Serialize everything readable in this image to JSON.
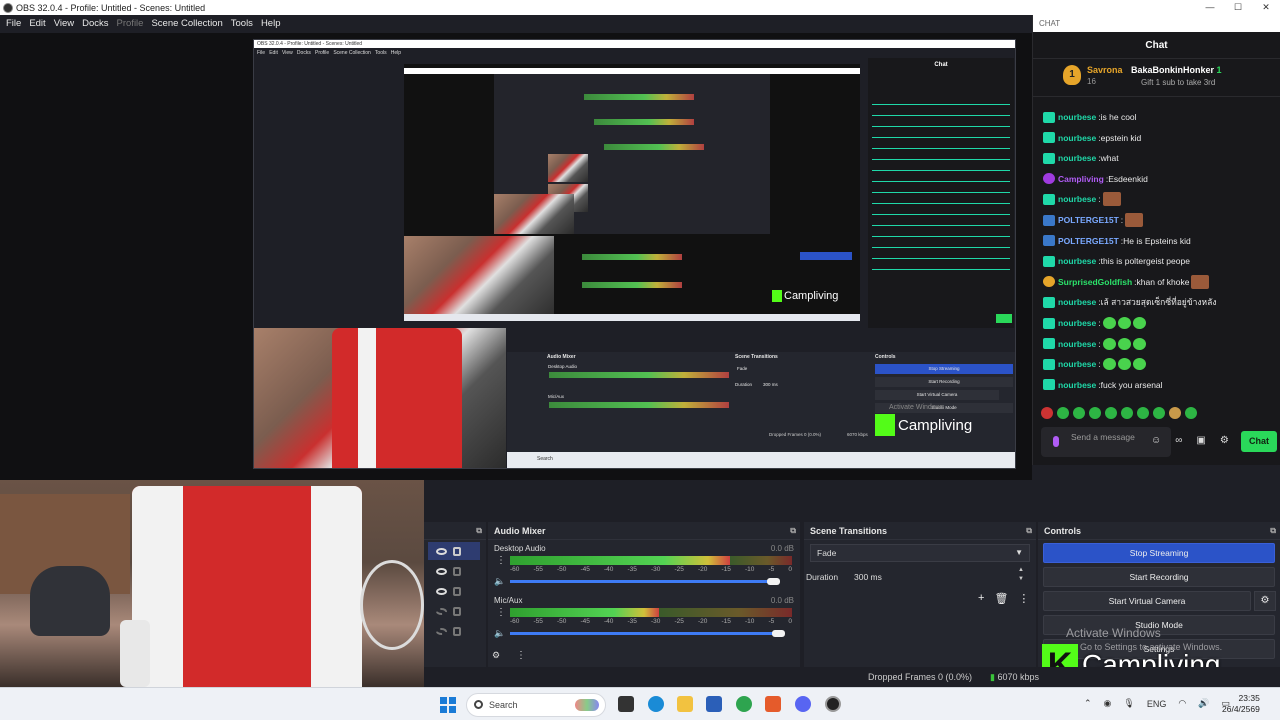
{
  "window": {
    "title": "OBS 32.0.4 - Profile: Untitled - Scenes: Untitled",
    "controls": [
      "—",
      "☐",
      "✕"
    ]
  },
  "menu": [
    "File",
    "Edit",
    "View",
    "Docks",
    "Profile",
    "Scene Collection",
    "Tools",
    "Help"
  ],
  "chat": {
    "dock_title": "CHAT",
    "header": "Chat",
    "gift": {
      "rank": "1",
      "user": "Savrona",
      "count": "16",
      "top_user": "BakaBonkinHonker",
      "top_count": "1",
      "subtext": "Gift 1 sub to take 3rd"
    },
    "messages": [
      {
        "user": "nourbese",
        "text": "is he cool",
        "kind": "t"
      },
      {
        "user": "nourbese",
        "text": "epstein kid",
        "kind": "t"
      },
      {
        "user": "nourbese",
        "text": "what",
        "kind": "t"
      },
      {
        "user": "Campliving",
        "text": "Esdeenkid",
        "kind": "p"
      },
      {
        "user": "nourbese",
        "text": "",
        "kind": "t",
        "emote": true
      },
      {
        "user": "POLTERGE15T",
        "text": "",
        "kind": "b",
        "emote": true
      },
      {
        "user": "POLTERGE15T",
        "text": "He is Epsteins kid",
        "kind": "b"
      },
      {
        "user": "nourbese",
        "text": "this is poltergeist peope",
        "kind": "t"
      },
      {
        "user": "SurprisedGoldfish",
        "text": "khan of khoke",
        "kind": "g",
        "emote": true
      },
      {
        "user": "nourbese",
        "text": "เล้ สาวสวยสุดเซ็กซี่ที่อยู่ข้างหลัง",
        "kind": "t"
      },
      {
        "user": "nourbese",
        "text": "",
        "kind": "t",
        "gemote": true
      },
      {
        "user": "nourbese",
        "text": "",
        "kind": "t",
        "gemote": true
      },
      {
        "user": "nourbese",
        "text": "",
        "kind": "t",
        "gemote": true
      },
      {
        "user": "nourbese",
        "text": "fuck you arsenal",
        "kind": "t"
      }
    ],
    "input_placeholder": "Send a message",
    "send_label": "Chat"
  },
  "docks": {
    "audio_mixer": {
      "title": "Audio Mixer",
      "scale": [
        "-60",
        "-55",
        "-50",
        "-45",
        "-40",
        "-35",
        "-30",
        "-25",
        "-20",
        "-15",
        "-10",
        "-5",
        "0"
      ],
      "channels": [
        {
          "name": "Desktop Audio",
          "db": "0.0 dB",
          "level": 0.78,
          "volume": 0.98
        },
        {
          "name": "Mic/Aux",
          "db": "0.0 dB",
          "level": 0.53,
          "volume": 1.0
        }
      ]
    },
    "scene_transitions": {
      "title": "Scene Transitions",
      "transition": "Fade",
      "duration_label": "Duration",
      "duration_value": "300 ms"
    },
    "controls": {
      "title": "Controls",
      "stop_streaming": "Stop Streaming",
      "start_recording": "Start Recording",
      "start_virtual_camera": "Start Virtual Camera",
      "studio_mode": "Studio Mode",
      "settings": "Settings"
    }
  },
  "watermark": {
    "activate": "Activate Windows",
    "settings_hint": "Go to Settings to activate Windows."
  },
  "overlay": {
    "k": "K",
    "channel": "Campliving"
  },
  "status": {
    "dropped": "Dropped Frames 0 (0.0%)",
    "kbps": "6070 kbps"
  },
  "taskbar": {
    "search": "Search",
    "lang": "ENG",
    "time": "23:35",
    "date": "26/4/2569"
  },
  "nested_preview": {
    "title": "OBS 32.0.4 - Profile: Untitled - Scenes: Untitled",
    "menu": "File   Edit   View   Docks   Profile   Scene Collection   Tools   Help",
    "chat": "Chat",
    "audio": "Audio Mixer",
    "transitions": "Scene Transitions",
    "controls": "Controls",
    "stop": "Stop Streaming",
    "rec": "Start Recording",
    "vcam": "Start Virtual Camera",
    "studio": "Studio Mode",
    "fade": "Fade",
    "duration": "Duration",
    "dur_val": "300 ms",
    "desktop": "Desktop Audio",
    "mic": "Mic/Aux",
    "dropped": "Dropped Frames 0 (0.0%)",
    "kbps": "6070 kbps",
    "channel": "Campliving",
    "search": "Search",
    "activate": "Activate Windows"
  }
}
